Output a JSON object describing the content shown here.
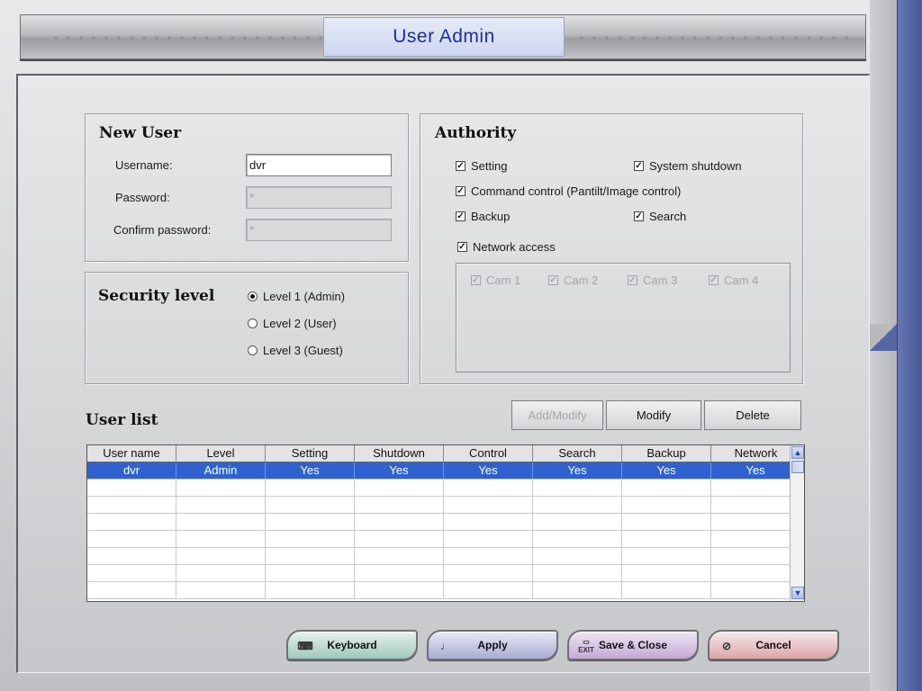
{
  "window": {
    "title": "User Admin"
  },
  "new_user": {
    "heading": "New User",
    "username_label": "Username:",
    "username_value": "dvr",
    "password_label": "Password:",
    "password_value": "*",
    "confirm_label": "Confirm password:",
    "confirm_value": "*"
  },
  "security": {
    "heading": "Security level",
    "options": [
      "Level 1 (Admin)",
      "Level 2 (User)",
      "Level 3 (Guest)"
    ],
    "selected": "Level 1 (Admin)"
  },
  "authority": {
    "heading": "Authority",
    "setting": {
      "label": "Setting",
      "checked": true
    },
    "system_shutdown": {
      "label": "System shutdown",
      "checked": true
    },
    "command_control": {
      "label": "Command control (Pantilt/Image control)",
      "checked": true
    },
    "backup": {
      "label": "Backup",
      "checked": true
    },
    "search": {
      "label": "Search",
      "checked": true
    },
    "network_access": {
      "label": "Network access",
      "checked": true
    },
    "cams": [
      {
        "label": "Cam 1",
        "checked": true
      },
      {
        "label": "Cam 2",
        "checked": true
      },
      {
        "label": "Cam 3",
        "checked": true
      },
      {
        "label": "Cam 4",
        "checked": true
      }
    ]
  },
  "user_list": {
    "heading": "User list",
    "buttons": {
      "add_modify": "Add/Modify",
      "modify": "Modify",
      "delete": "Delete"
    },
    "columns": [
      "User name",
      "Level",
      "Setting",
      "Shutdown",
      "Control",
      "Search",
      "Backup",
      "Network"
    ],
    "rows": [
      [
        "dvr",
        "Admin",
        "Yes",
        "Yes",
        "Yes",
        "Yes",
        "Yes",
        "Yes"
      ]
    ],
    "selected_row": 0
  },
  "footer": {
    "keyboard": "Keyboard",
    "keyboard_icon": "keyboard-icon",
    "apply": "Apply",
    "apply_icon": "apply-icon",
    "save_close": "Save & Close",
    "save_icon": "exit-icon",
    "cancel": "Cancel",
    "cancel_icon": "cancel-icon"
  },
  "colors": {
    "title_text": "#1c2f9a",
    "selection": "#2f62cf",
    "right_bevel": "#5466a4"
  }
}
